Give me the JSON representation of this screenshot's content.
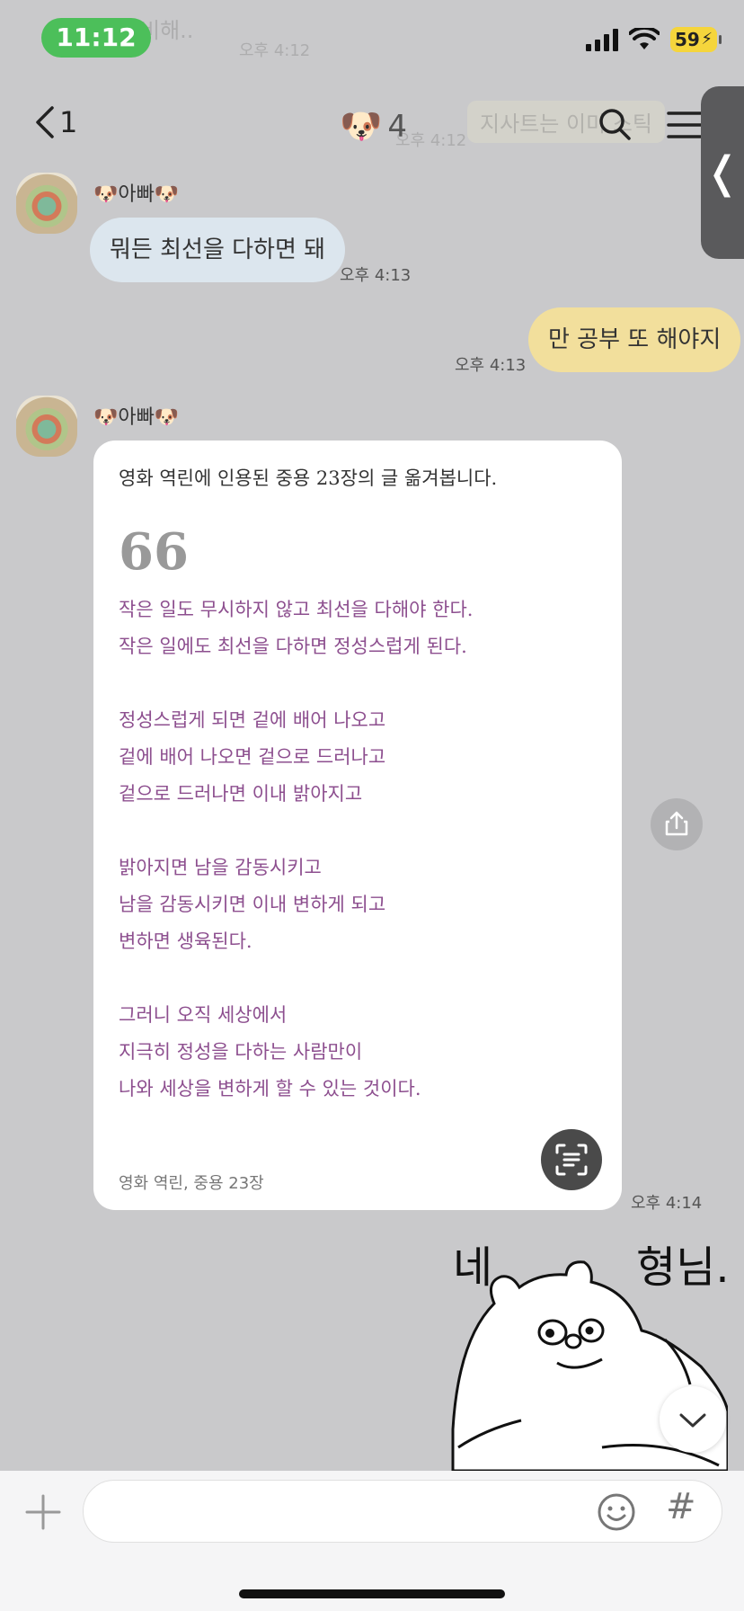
{
  "status_bar": {
    "time": "11:12",
    "battery": "59"
  },
  "ghost_text": {
    "line1": "비해..",
    "line2": "오후 4:12",
    "line3": "지사트는 이미 스틱",
    "line4": "오후 4:12"
  },
  "nav": {
    "unread_count": "1",
    "room_emoji": "🐶",
    "member_count": "4",
    "side_tab_glyph": "❬"
  },
  "messages": [
    {
      "sender": "🐶아빠🐶",
      "text": "뭐든 최선을 다하면 돼",
      "time": "오후 4:13"
    },
    {
      "text": "만 공부 또 해야지",
      "time": "오후 4:13"
    },
    {
      "sender": "🐶아빠🐶",
      "time": "오후 4:14"
    }
  ],
  "image_card": {
    "intro": "영화 역린에 인용된 중용 23장의 글 옮겨봅니다.",
    "quote_mark": "66",
    "lines": [
      "작은 일도 무시하지 않고 최선을 다해야 한다.",
      "작은 일에도 최선을 다하면 정성스럽게 된다.",
      "",
      "정성스럽게 되면 겉에 배어 나오고",
      "겉에 배어 나오면 겉으로 드러나고",
      "겉으로 드러나면 이내 밝아지고",
      "",
      "밝아지면 남을 감동시키고",
      "남을 감동시키면 이내 변하게 되고",
      "변하면 생육된다.",
      "",
      "그러니 오직 세상에서",
      "지극히 정성을 다하는 사람만이",
      "나와 세상을 변하게 할 수 있는 것이다."
    ],
    "source": "영화 역린, 중용 23장"
  },
  "sticker": {
    "left_text": "네",
    "right_text": "형님."
  },
  "input_bar": {
    "placeholder": "",
    "hash_label": "#"
  },
  "colors": {
    "background": "#c9c9cb",
    "incoming_bubble": "#dce6ee",
    "outgoing_bubble": "#f2df9c",
    "quote_text": "#8d4f8f",
    "time_pill": "#4cbf5a",
    "battery": "#f5d53c"
  },
  "icons": {
    "back": "chevron-left-icon",
    "search": "search-icon",
    "menu": "hamburger-menu-icon",
    "share": "share-icon",
    "scan": "text-scan-icon",
    "scroll_down": "chevron-down-icon",
    "plus": "plus-icon",
    "emoji": "emoji-icon"
  }
}
